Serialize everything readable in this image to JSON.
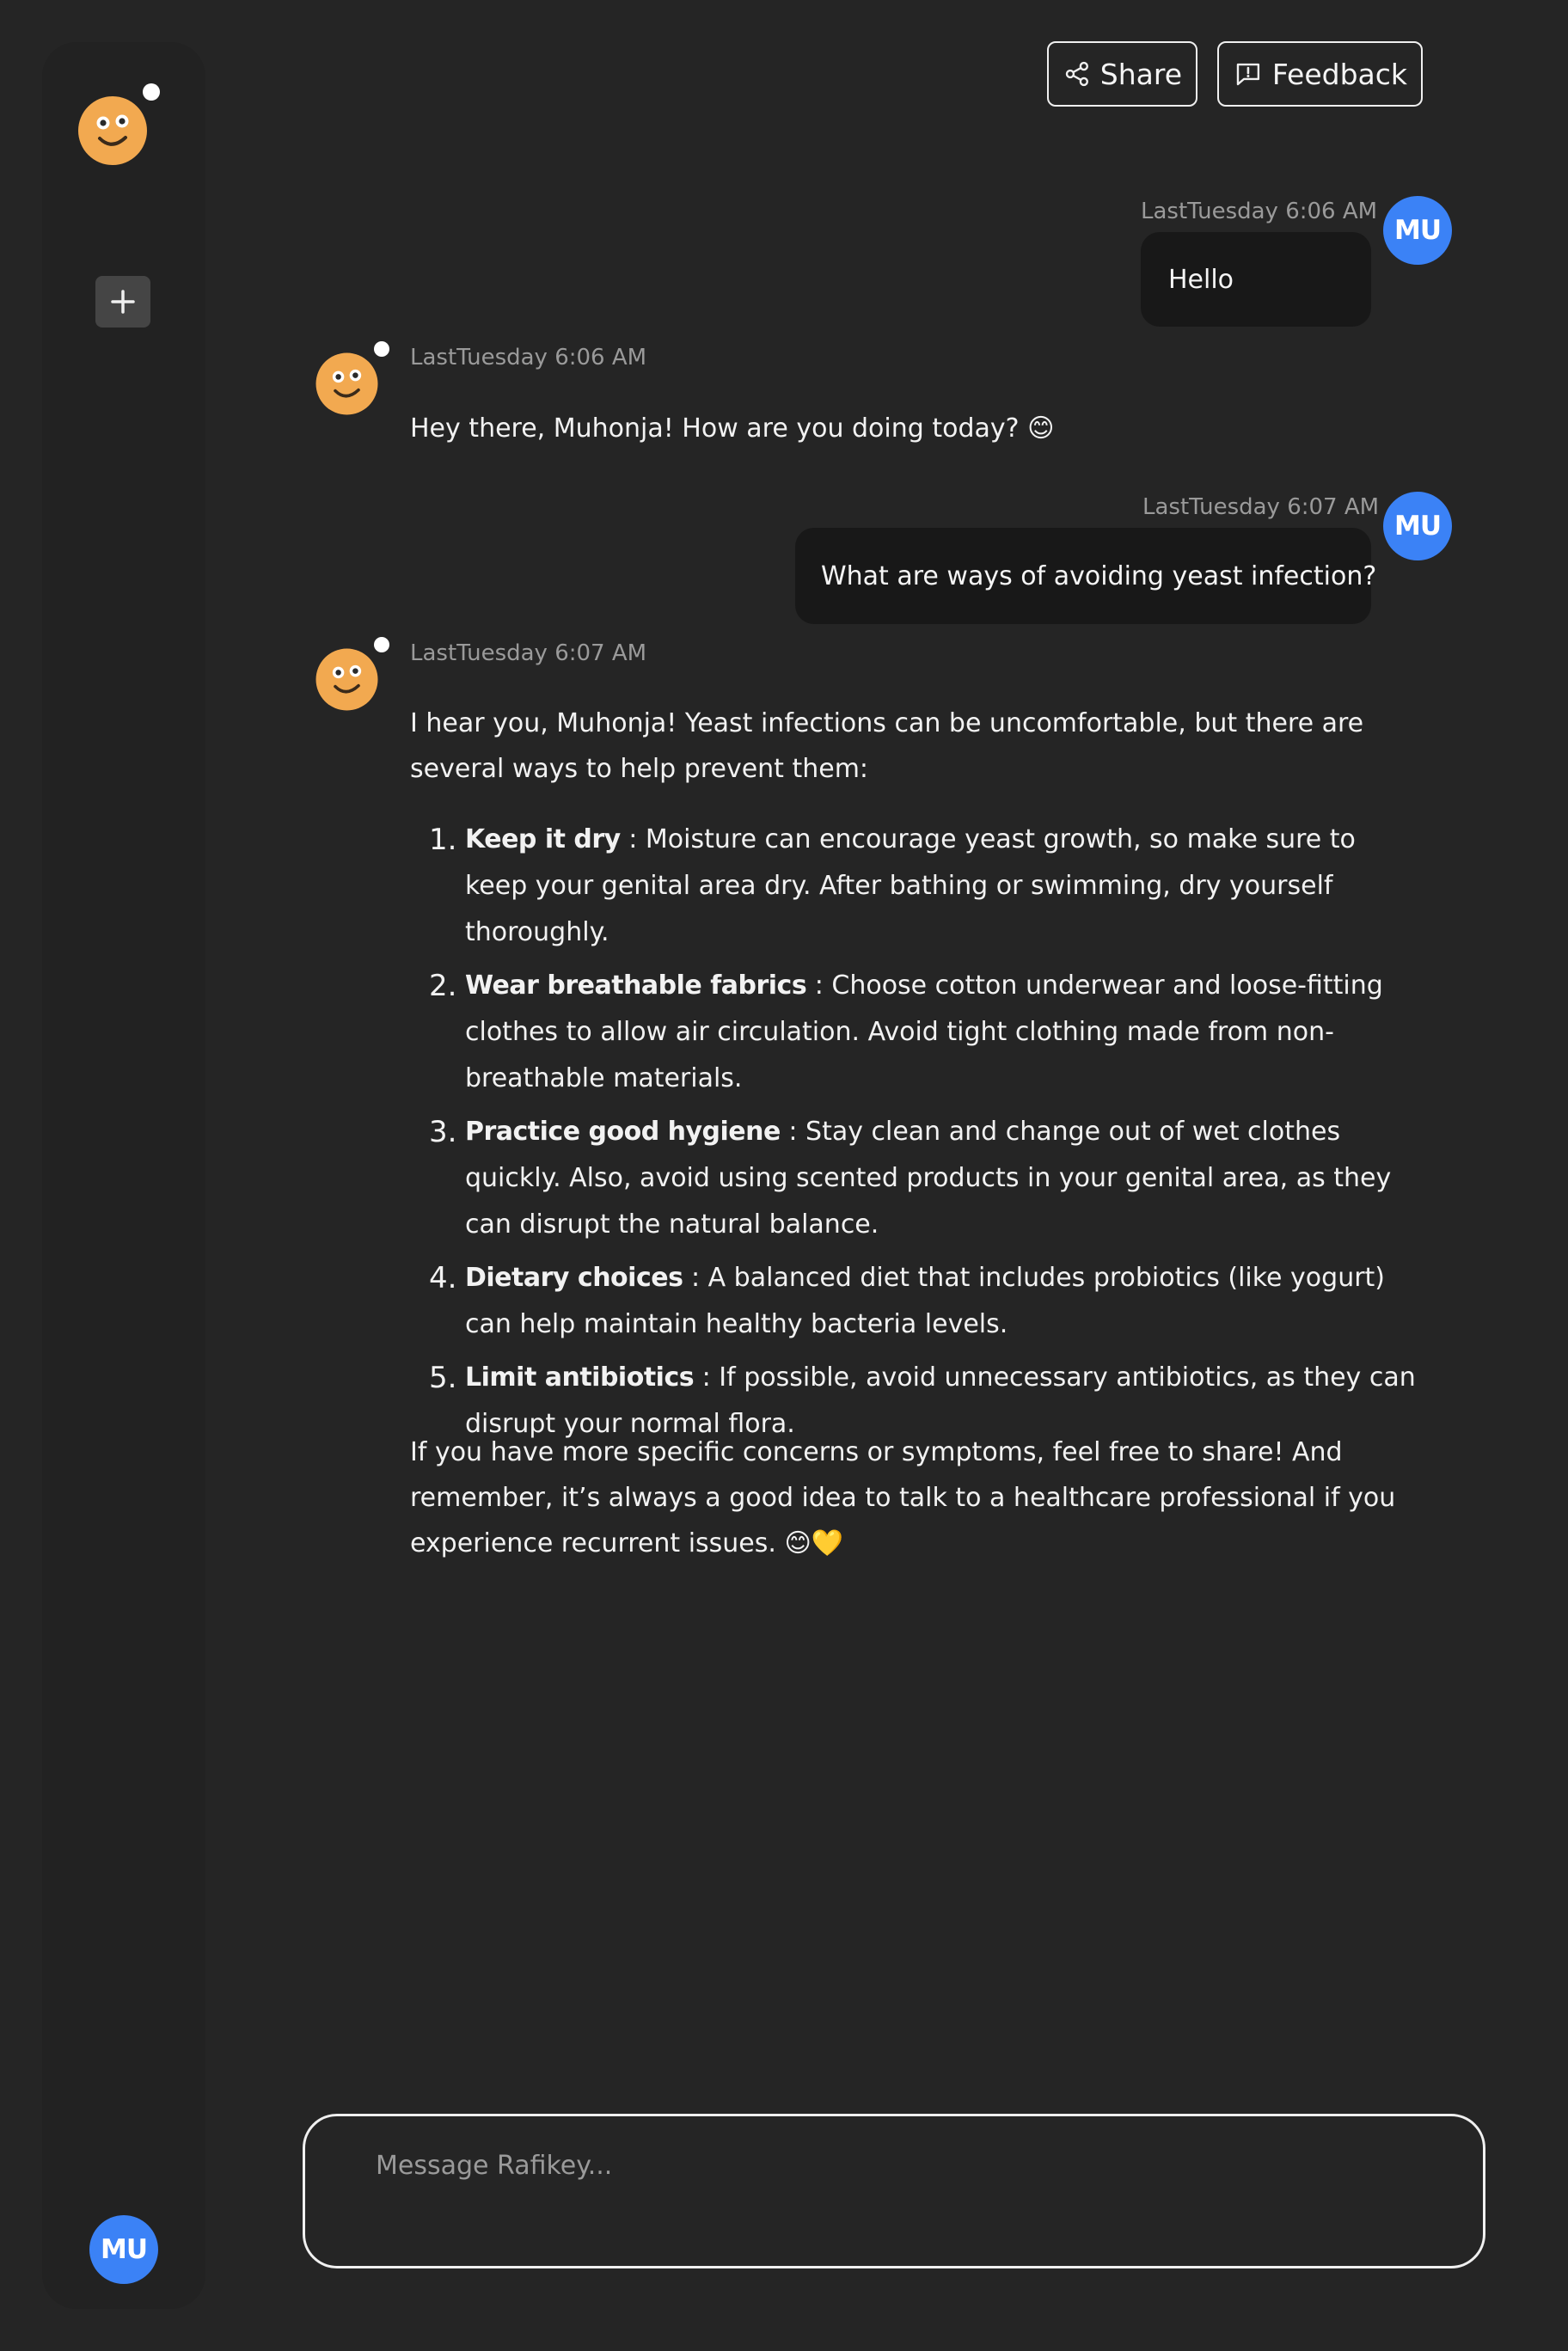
{
  "header": {
    "share_label": "Share",
    "feedback_label": "Feedback"
  },
  "sidebar": {
    "new_chat_icon": "plus-icon",
    "user_initials": "MU"
  },
  "colors": {
    "background": "#252525",
    "sidebar": "#222222",
    "user_bubble": "#181818",
    "avatar_blue": "#3b82f6",
    "bot_face": "#f2a950"
  },
  "messages": [
    {
      "role": "user",
      "initials": "MU",
      "timestamp": "LastTuesday 6:06 AM",
      "text": "Hello"
    },
    {
      "role": "assistant",
      "timestamp": "LastTuesday 6:06 AM",
      "text": "Hey there, Muhonja! How are you doing today? 😊"
    },
    {
      "role": "user",
      "initials": "MU",
      "timestamp": "LastTuesday 6:07 AM",
      "text": "What are ways of avoiding yeast infection?"
    },
    {
      "role": "assistant",
      "timestamp": "LastTuesday 6:07 AM",
      "intro": "I hear you, Muhonja! Yeast infections can be uncomfortable, but there are several ways to help prevent them:",
      "items": [
        {
          "number": "1.",
          "title": "Keep it dry",
          "text": " : Moisture can encourage yeast growth, so make sure to keep your genital area dry. After bathing or swimming, dry yourself thoroughly."
        },
        {
          "number": "2.",
          "title": "Wear breathable fabrics",
          "text": " : Choose cotton underwear and loose-fitting clothes to allow air circulation. Avoid tight clothing made from non-breathable materials."
        },
        {
          "number": "3.",
          "title": "Practice good hygiene",
          "text": " : Stay clean and change out of wet clothes quickly. Also, avoid using scented products in your genital area, as they can disrupt the natural balance."
        },
        {
          "number": "4.",
          "title": "Dietary choices",
          "text": " : A balanced diet that includes probiotics (like yogurt) can help maintain healthy bacteria levels."
        },
        {
          "number": "5.",
          "title": "Limit antibiotics",
          "text": " : If possible, avoid unnecessary antibiotics, as they can disrupt your normal flora."
        }
      ],
      "outro": "If you have more specific concerns or symptoms, feel free to share! And remember, it’s always a good idea to talk to a healthcare professional if you experience recurrent issues. 😊💛"
    }
  ],
  "composer": {
    "placeholder": "Message Rafikey..."
  }
}
